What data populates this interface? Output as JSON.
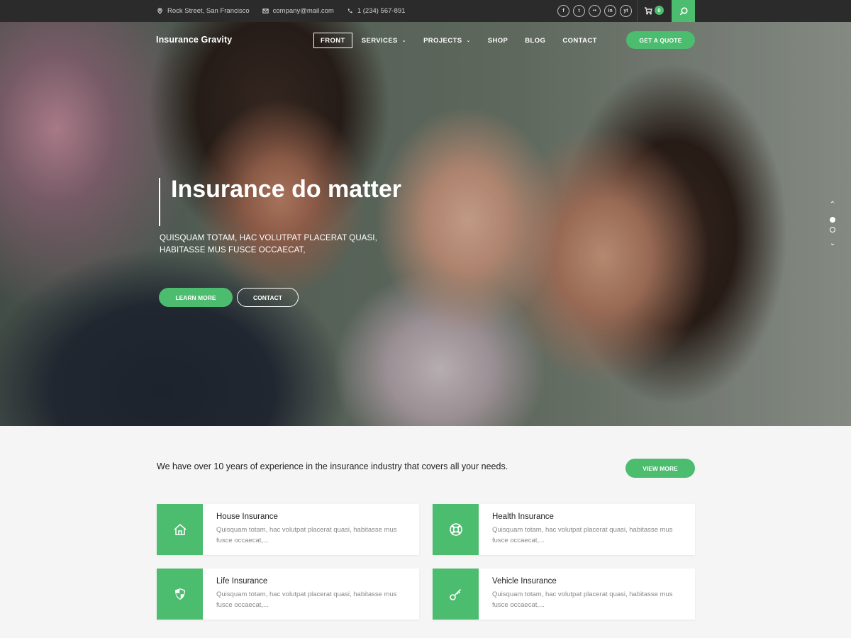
{
  "topbar": {
    "address": "Rock Street, San Francisco",
    "email": "company@mail.com",
    "phone": "1 (234) 567-891",
    "socials": [
      "f",
      "t",
      "••",
      "in",
      "yt"
    ],
    "cart_count": "0"
  },
  "header": {
    "logo": "Insurance Gravity",
    "nav": [
      {
        "label": "FRONT",
        "active": true
      },
      {
        "label": "SERVICES",
        "dropdown": true
      },
      {
        "label": "PROJECTS",
        "dropdown": true
      },
      {
        "label": "SHOP"
      },
      {
        "label": "BLOG"
      },
      {
        "label": "CONTACT"
      }
    ],
    "cta": "GET A QUOTE"
  },
  "hero": {
    "title": "Insurance do matter",
    "subtitle": "QUISQUAM TOTAM, HAC VOLUTPAT PLACERAT QUASI, HABITASSE MUS FUSCE OCCAECAT,",
    "learn_more": "LEARN MORE",
    "contact": "CONTACT"
  },
  "intro": {
    "tagline": "We have over 10 years of experience in the insurance industry that covers all your needs.",
    "view_more": "VIEW MORE"
  },
  "services": [
    {
      "title": "House Insurance",
      "desc": "Quisquam totam, hac volutpat placerat quasi, habitasse mus fusce occaecat,...",
      "icon": "house-icon"
    },
    {
      "title": "Health Insurance",
      "desc": "Quisquam totam, hac volutpat placerat quasi, habitasse mus fusce occaecat,...",
      "icon": "lifebuoy-icon"
    },
    {
      "title": "Life Insurance",
      "desc": "Quisquam totam, hac volutpat placerat quasi, habitasse mus fusce occaecat,...",
      "icon": "shield-icon"
    },
    {
      "title": "Vehicle Insurance",
      "desc": "Quisquam totam, hac volutpat placerat quasi, habitasse mus fusce occaecat,...",
      "icon": "key-icon"
    }
  ],
  "colors": {
    "accent": "#4cbc6f",
    "topbar": "#2b2b2b",
    "background": "#f5f5f5"
  }
}
